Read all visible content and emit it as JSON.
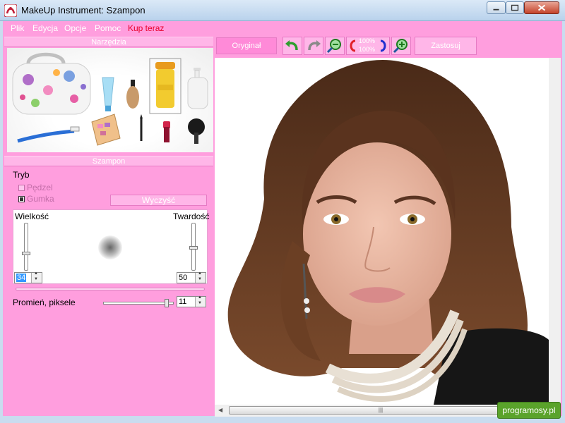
{
  "window": {
    "title": "MakeUp Instrument: Szampon"
  },
  "menu": {
    "items": [
      "Plik",
      "Edycja",
      "Opcje",
      "Pomoc"
    ],
    "buy": "Kup teraz"
  },
  "left": {
    "tools_header": "Narzędzia",
    "section_header": "Szampon",
    "mode_label": "Tryb",
    "brush_label": "Pędzel",
    "eraser_label": "Gumka",
    "clear_button": "Wyczyść",
    "size_label": "Wielkość",
    "hardness_label": "Twardość",
    "size_value": "34",
    "hardness_value": "50",
    "radius_label": "Promień, piksele",
    "radius_value": "11"
  },
  "toolbar": {
    "original_button": "Oryginał",
    "apply_button": "Zastosuj",
    "zoom_top": "100%",
    "zoom_bottom": "100%"
  },
  "watermark": "programosy.pl",
  "colors": {
    "panel": "#ff9ede",
    "header": "#ffb6e8",
    "buy": "#e8002a"
  }
}
